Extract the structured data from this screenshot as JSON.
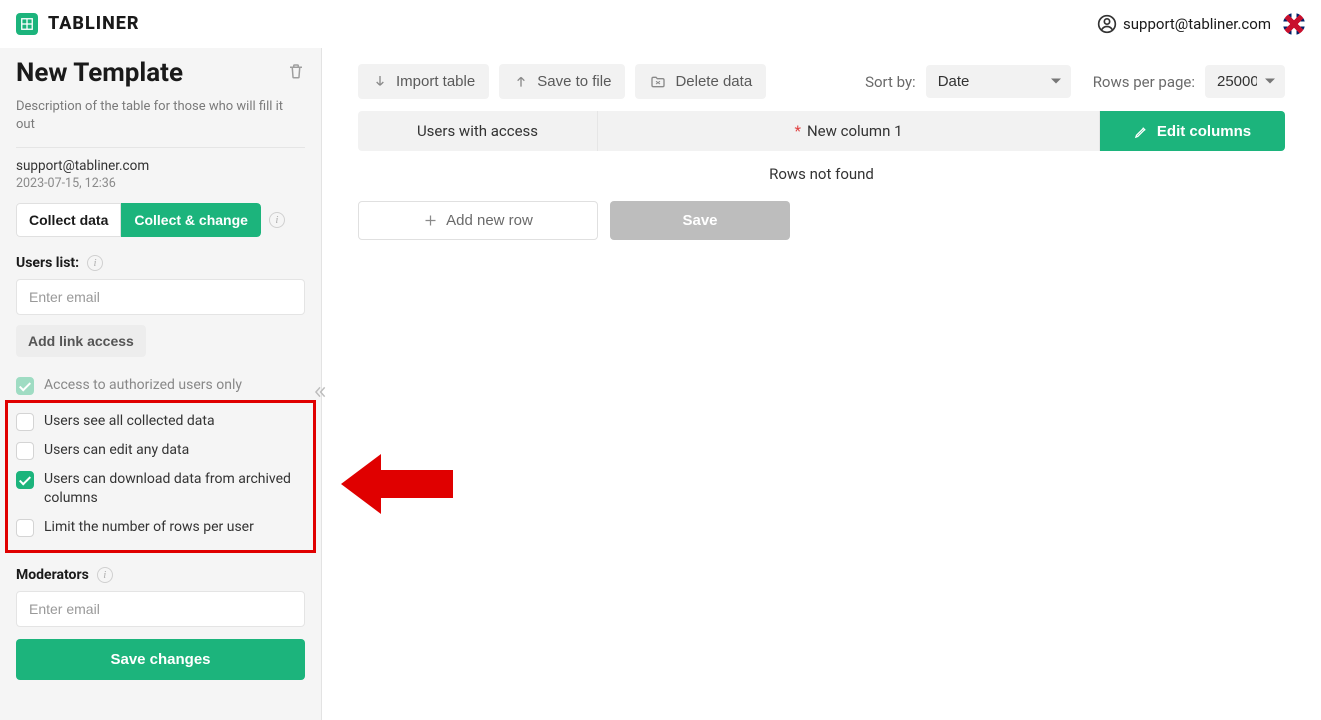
{
  "brand": "TABLINER",
  "header": {
    "user_email": "support@tabliner.com"
  },
  "sidebar": {
    "title": "New Template",
    "description": "Description of the table for those who will fill it out",
    "owner_email": "support@tabliner.com",
    "timestamp": "2023-07-15, 12:36",
    "mode_tabs": {
      "collect": "Collect data",
      "collect_change": "Collect & change"
    },
    "users_list_label": "Users list:",
    "email_placeholder": "Enter email",
    "add_link_access": "Add link access",
    "checkboxes": {
      "authorized": "Access to authorized users only",
      "see_all": "Users see all collected data",
      "edit_any": "Users can edit any data",
      "download_archived": "Users can download data from archived columns",
      "limit_rows": "Limit the number of rows per user"
    },
    "moderators_label": "Moderators",
    "moderators_placeholder": "Enter email",
    "save_changes": "Save changes"
  },
  "toolbar": {
    "import_table": "Import table",
    "save_to_file": "Save to file",
    "delete_data": "Delete data",
    "sort_by_label": "Sort by:",
    "sort_by_value": "Date",
    "rows_per_page_label": "Rows per page:",
    "rows_per_page_value": "25000"
  },
  "table": {
    "col1": "Users with access",
    "col2": "New column 1",
    "edit_columns": "Edit columns",
    "empty": "Rows not found",
    "add_row": "Add new row",
    "save": "Save"
  },
  "colors": {
    "accent": "#1cb47c",
    "highlight": "#e00000"
  }
}
